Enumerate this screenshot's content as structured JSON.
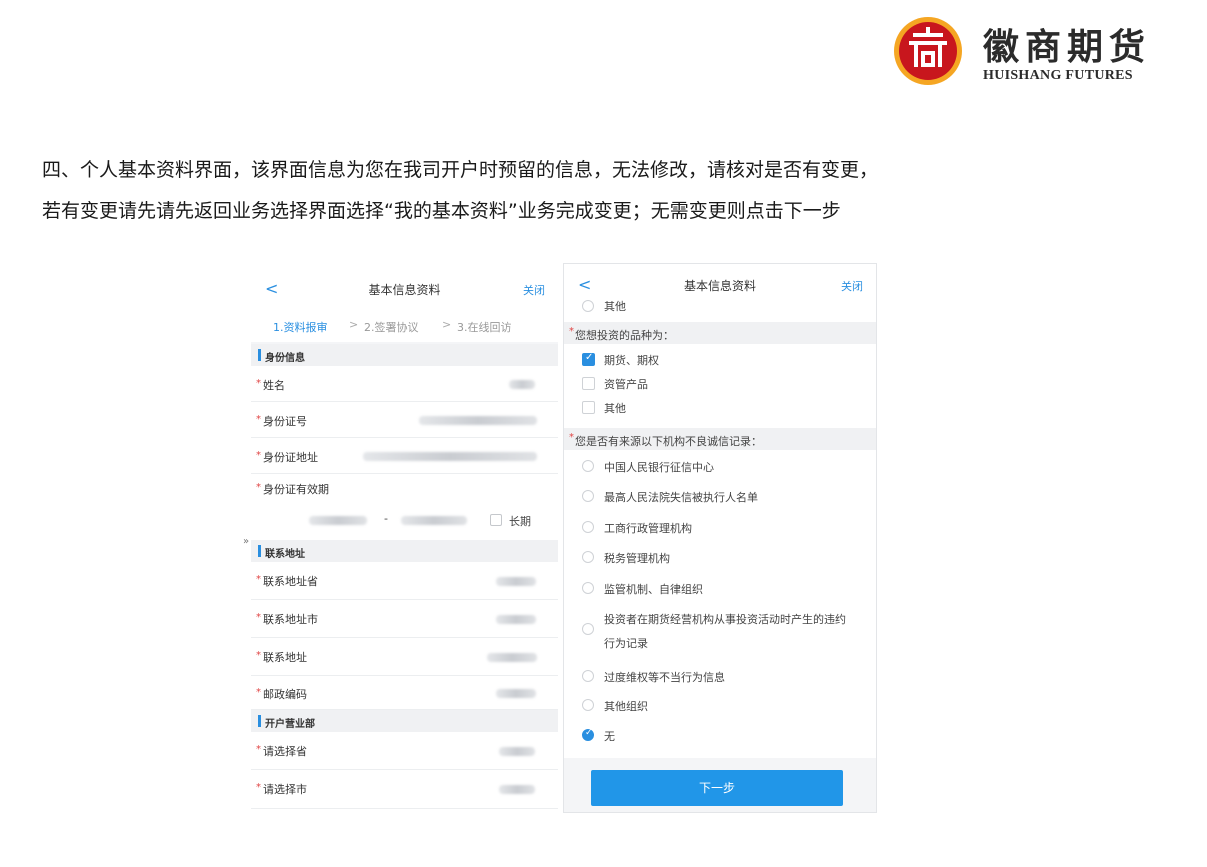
{
  "logo": {
    "name_cn": "徽商期货",
    "name_en": "HUISHANG FUTURES",
    "icon": "huishang-emblem-icon",
    "colors": {
      "red": "#c8161d",
      "gold": "#f5a623"
    }
  },
  "instruction": {
    "line1": "四、个人基本资料界面，该界面信息为您在我司开户时预留的信息，无法修改，请核对是否有变更，",
    "line2": "若有变更请先请先返回业务选择界面选择“我的基本资料”业务完成变更；无需变更则点击下一步"
  },
  "edge_mark": "»",
  "left_screen": {
    "back": "<",
    "title": "基本信息资料",
    "close": "关闭",
    "steps": [
      "1.资料报审",
      "2.签署协议",
      "3.在线回访"
    ],
    "step_sep": ">",
    "sections": {
      "identity": "身份信息",
      "contact": "联系地址",
      "branch": "开户营业部"
    },
    "fields": {
      "name": "姓名",
      "id_number": "身份证号",
      "id_address": "身份证地址",
      "id_validity": "身份证有效期",
      "date_dash": "-",
      "long_term": "长期",
      "province": "联系地址省",
      "city": "联系地址市",
      "address": "联系地址",
      "postcode": "邮政编码",
      "branch_province": "请选择省",
      "branch_city": "请选择市"
    },
    "required_mark": "*"
  },
  "right_screen": {
    "back": "<",
    "title": "基本信息资料",
    "close": "关闭",
    "top_cut_option": "其他",
    "q1": "您想投资的品种为：",
    "q1_options": [
      {
        "label": "期货、期权",
        "checked": true
      },
      {
        "label": "资管产品",
        "checked": false
      },
      {
        "label": "其他",
        "checked": false
      }
    ],
    "q2": "您是否有来源以下机构不良诚信记录：",
    "q2_options": [
      {
        "label": "中国人民银行征信中心",
        "checked": false
      },
      {
        "label": "最高人民法院失信被执行人名单",
        "checked": false
      },
      {
        "label": "工商行政管理机构",
        "checked": false
      },
      {
        "label": "税务管理机构",
        "checked": false
      },
      {
        "label": "监管机制、自律组织",
        "checked": false
      },
      {
        "label": "投资者在期货经营机构从事投资活动时产生的违约",
        "label2": "行为记录",
        "checked": false
      },
      {
        "label": "过度维权等不当行为信息",
        "checked": false
      },
      {
        "label": "其他组织",
        "checked": false
      },
      {
        "label": "无",
        "checked": true
      }
    ],
    "next_button": "下一步",
    "required_mark": "*"
  },
  "colors": {
    "accent": "#2a8fe0",
    "required": "#e04545",
    "button": "#2196e8"
  }
}
